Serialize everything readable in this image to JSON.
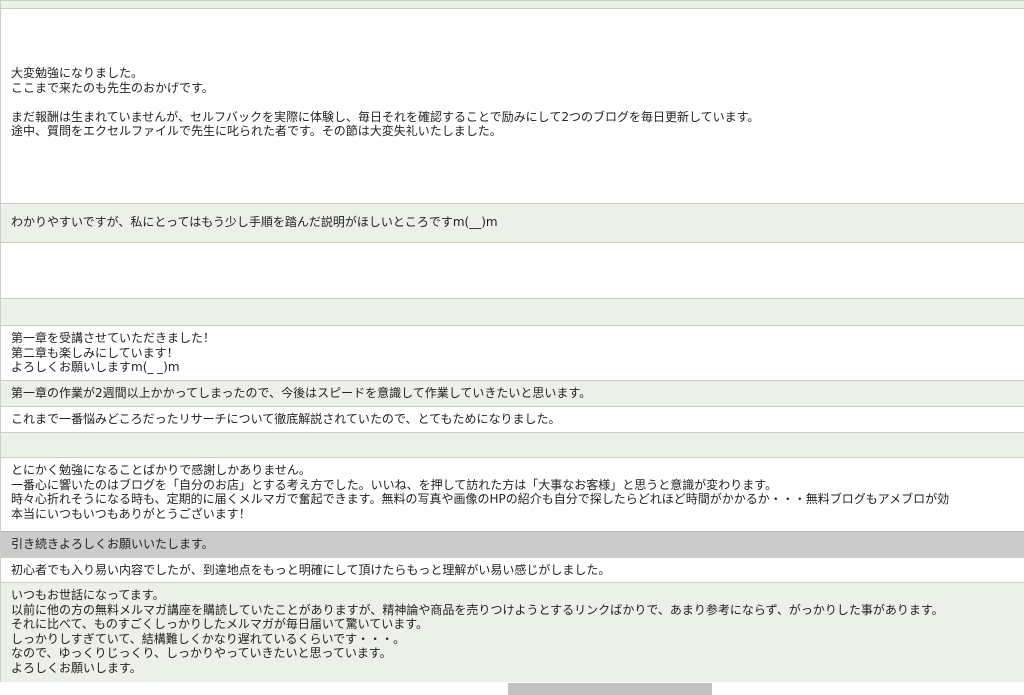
{
  "comments": [
    {
      "lines": []
    },
    {
      "lines": [
        "大変勉強になりました。",
        "ここまで来たのも先生のおかげです。",
        "",
        "まだ報酬は生まれていませんが、セルフバックを実際に体験し、毎日それを確認することで励みにして2つのブログを毎日更新しています。",
        "途中、質問をエクセルファイルで先生に叱られた者です。その節は大変失礼いたしました。"
      ]
    },
    {
      "lines": [
        "わかりやすいですが、私にとってはもう少し手順を踏んだ説明がほしいところですm(__)m"
      ]
    },
    {
      "lines": []
    },
    {
      "lines": []
    },
    {
      "lines": [
        "第一章を受講させていただきました！",
        "第二章も楽しみにしています！",
        "よろしくお願いしますm(_ _)m"
      ]
    },
    {
      "lines": [
        "第一章の作業が2週間以上かかってしまったので、今後はスピードを意識して作業していきたいと思います。"
      ]
    },
    {
      "lines": [
        "これまで一番悩みどころだったリサーチについて徹底解説されていたので、とてもためになりました。"
      ]
    },
    {
      "lines": []
    },
    {
      "lines": [
        "とにかく勉強になることばかりで感謝しかありません。",
        "一番心に響いたのはブログを「自分のお店」とする考え方でした。いいね、を押して訪れた方は「大事なお客様」と思うと意識が変わります。",
        "時々心折れそうになる時も、定期的に届くメルマガで奮起できます。無料の写真や画像のHPの紹介も自分で探したらどれほど時間がかかるか・・・無料ブログもアメブロが効",
        "本当にいつもいつもありがとうございます！"
      ]
    },
    {
      "lines": [
        "引き続きよろしくお願いいたします。"
      ]
    },
    {
      "lines": [
        "初心者でも入り易い内容でしたが、到達地点をもっと明確にして頂けたらもっと理解がい易い感じがしました。"
      ]
    },
    {
      "lines": [
        "いつもお世話になってます。",
        "以前に他の方の無料メルマガ講座を購読していたことがありますが、精神論や商品を売りつけようとするリンクばかりで、あまり参考にならず、がっかりした事があります。",
        "それに比べて、ものすごくしっかりしたメルマガが毎日届いて驚いています。",
        "しっかりしすぎていて、結構難しくかなり遅れているくらいです・・・。",
        "なので、ゆっくりじっくり、しっかりやっていきたいと思っています。",
        "よろしくお願いします。"
      ]
    }
  ]
}
